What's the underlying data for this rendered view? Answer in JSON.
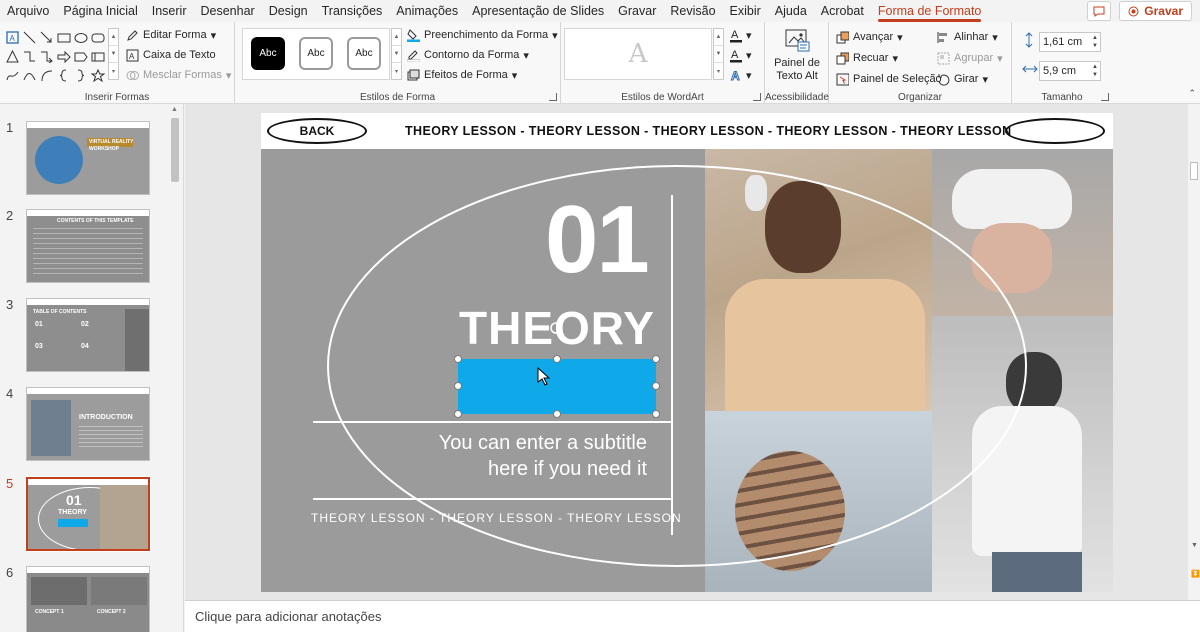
{
  "tabs": [
    {
      "label": "Arquivo",
      "active": false
    },
    {
      "label": "Página Inicial",
      "active": false
    },
    {
      "label": "Inserir",
      "active": false
    },
    {
      "label": "Desenhar",
      "active": false
    },
    {
      "label": "Design",
      "active": false
    },
    {
      "label": "Transições",
      "active": false
    },
    {
      "label": "Animações",
      "active": false
    },
    {
      "label": "Apresentação de Slides",
      "active": false
    },
    {
      "label": "Gravar",
      "active": false
    },
    {
      "label": "Revisão",
      "active": false
    },
    {
      "label": "Exibir",
      "active": false
    },
    {
      "label": "Ajuda",
      "active": false
    },
    {
      "label": "Acrobat",
      "active": false
    },
    {
      "label": "Forma de Formato",
      "active": true
    }
  ],
  "titlebar": {
    "record_label": "Gravar"
  },
  "ribbon": {
    "insert_shapes": {
      "label": "Inserir Formas",
      "edit_shape": "Editar Forma",
      "text_box": "Caixa de Texto",
      "merge_shapes": "Mesclar Formas"
    },
    "shape_styles": {
      "label": "Estilos de Forma",
      "style_chips": [
        "Abc",
        "Abc",
        "Abc"
      ],
      "fill": "Preenchimento da Forma",
      "outline": "Contorno da Forma",
      "effects": "Efeitos de Forma"
    },
    "wordart": {
      "label": "Estilos de WordArt",
      "preview_glyph": "A"
    },
    "accessibility": {
      "label": "Acessibilidade",
      "alt_text_line1": "Painel de",
      "alt_text_line2": "Texto Alt"
    },
    "arrange": {
      "label": "Organizar",
      "bring_forward": "Avançar",
      "send_backward": "Recuar",
      "selection_pane": "Painel de Seleção",
      "align": "Alinhar",
      "group": "Agrupar",
      "rotate": "Girar"
    },
    "size": {
      "label": "Tamanho",
      "height": "1,61 cm",
      "width": "5,9 cm"
    }
  },
  "thumbnails": [
    {
      "num": "1",
      "selected": false,
      "caption": "VIRTUAL REALITY WORKSHOP"
    },
    {
      "num": "2",
      "selected": false,
      "caption": "CONTENTS OF THIS TEMPLATE"
    },
    {
      "num": "3",
      "selected": false,
      "caption": "TABLE OF CONTENTS"
    },
    {
      "num": "4",
      "selected": false,
      "caption": "INTRODUCTION"
    },
    {
      "num": "5",
      "selected": true,
      "caption": "01"
    },
    {
      "num": "6",
      "selected": false,
      "caption": "CONCEPT 1"
    }
  ],
  "thumb_labels": {
    "t3_items": [
      "01",
      "02",
      "03",
      "04"
    ],
    "t5_theory": "THEORY",
    "t6_concept2": "CONCEPT 2"
  },
  "slide": {
    "back_label": "BACK",
    "ticker": "THEORY LESSON - THEORY LESSON - THEORY LESSON - THEORY LESSON - THEORY LESSON",
    "number": "01",
    "title": "THEORY",
    "subtitle_line1": "You can enter a subtitle",
    "subtitle_line2": "here if you need it",
    "bottom_ticker": "THEORY LESSON - THEORY LESSON - THEORY LESSON",
    "selected_box_color": "#0fa9ea"
  },
  "notes": {
    "placeholder": "Clique para adicionar anotações"
  },
  "colors": {
    "accent": "#c43e1c",
    "slide_bg": "#9e9e9e"
  }
}
